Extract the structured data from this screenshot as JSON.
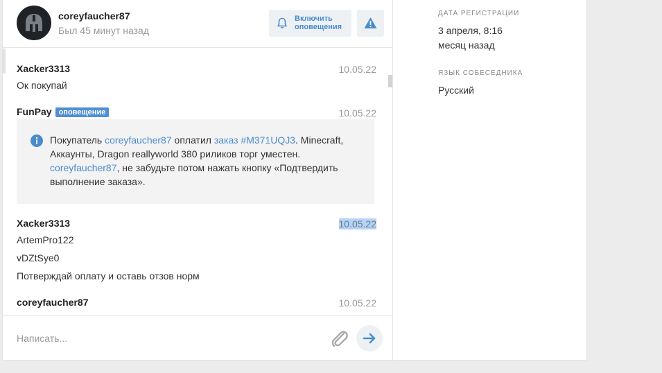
{
  "header": {
    "username": "coreyfaucher87",
    "last_seen": "Был 45 минут назад",
    "notify_line1": "Включить",
    "notify_line2": "оповещения"
  },
  "messages": [
    {
      "author": "Xacker3313",
      "date": "10.05.22",
      "lines": [
        "Ок покупай"
      ]
    },
    {
      "author": "FunPay",
      "badge": "оповещение",
      "date": "10.05.22",
      "alert": {
        "t1": "Покупатель ",
        "buyer": "coreyfaucher87",
        "t2": " оплатил ",
        "order": "заказ #M371UQJ3",
        "t3": ". Minecraft, Аккаунты, Dragon reallyworld 380 риликов торг уместен.",
        "buyer2": "coreyfaucher87",
        "t4": ", не забудьте потом нажать кнопку «Подтвердить выполнение заказа»."
      }
    },
    {
      "author": "Xacker3313",
      "date": "10.05.22",
      "lines": [
        "ArtemPro122",
        "vDZtSye0",
        "Потверждай оплату и оставь отзов норм"
      ]
    },
    {
      "author": "coreyfaucher87",
      "date": "10.05.22",
      "lines": []
    }
  ],
  "compose": {
    "placeholder": "Написать..."
  },
  "info": {
    "reg_label": "Дата регистрации",
    "reg_date": "3 апреля, 8:16",
    "reg_ago": "месяц назад",
    "lang_label": "Язык собеседника",
    "lang_value": "Русский"
  },
  "colors": {
    "accent": "#4a8bcd",
    "badge": "#4f8fd3",
    "alert_bg": "#f3f3f3",
    "button_bg": "#eef1f4"
  },
  "icons": [
    "helmet-avatar",
    "bell-icon",
    "warning-icon",
    "info-icon",
    "paperclip-icon",
    "arrow-right-icon"
  ]
}
